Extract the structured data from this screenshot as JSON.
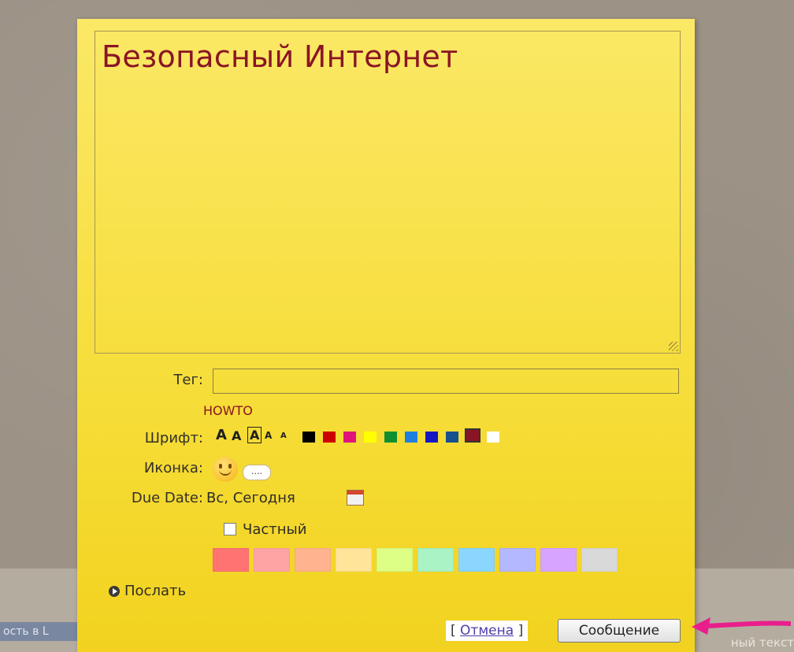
{
  "title": "Безопасный Интернет",
  "labels": {
    "tag": "Тег:",
    "font": "Шрифт:",
    "icon": "Иконка:",
    "due_date": "Due Date:"
  },
  "tag": {
    "value": "",
    "suggestion": "HOWTO"
  },
  "font_sizes": [
    "A",
    "A",
    "A",
    "A",
    "A"
  ],
  "font_colors": [
    "#000000",
    "#cc0000",
    "#e0157b",
    "#ffff00",
    "#0f8f2f",
    "#1f7fe0",
    "#1616c4",
    "#174f8f",
    "#8a1425",
    "#ffffff"
  ],
  "icon": {
    "name": "smile-icon",
    "more_label": "...."
  },
  "due_date_value": "Вс, Сегодня",
  "private_label": "Частный",
  "note_colors": [
    "#ff7373",
    "#ffa4a4",
    "#ffb38f",
    "#ffe49a",
    "#ddff86",
    "#a9f3c5",
    "#8ad6ff",
    "#b4b8ff",
    "#d7a5ff",
    "#d9d9d9"
  ],
  "send_label": "Послать",
  "cancel": {
    "open": "[",
    "text": "Отмена",
    "close": "]"
  },
  "submit_label": "Сообщение",
  "background": {
    "left_text": "ость в L",
    "right_text": "ный текст"
  }
}
